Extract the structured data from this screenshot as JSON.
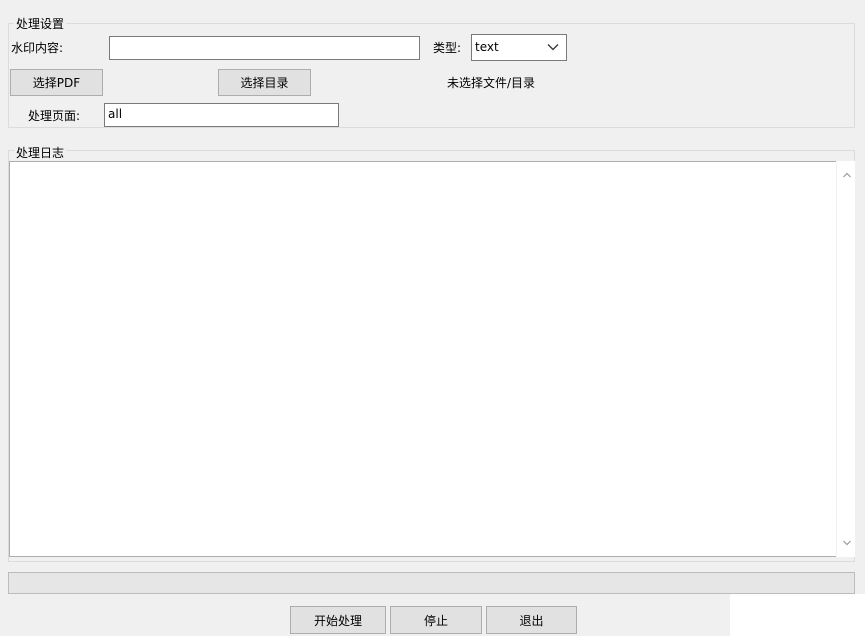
{
  "settings": {
    "title": "处理设置",
    "watermark_label": "水印内容:",
    "watermark_value": "",
    "type_label": "类型:",
    "type_value": "text",
    "select_pdf_button": "选择PDF",
    "select_dir_button": "选择目录",
    "selection_status": "未选择文件/目录",
    "pages_label": "处理页面:",
    "pages_value": "all"
  },
  "log": {
    "title": "处理日志",
    "content": ""
  },
  "progress": {
    "percent": 0
  },
  "footer": {
    "start_button": "开始处理",
    "stop_button": "停止",
    "exit_button": "退出"
  },
  "icons": {
    "combo_arrow": "chevron-down-icon",
    "scroll_up": "chevron-up-icon",
    "scroll_down": "chevron-down-icon"
  }
}
